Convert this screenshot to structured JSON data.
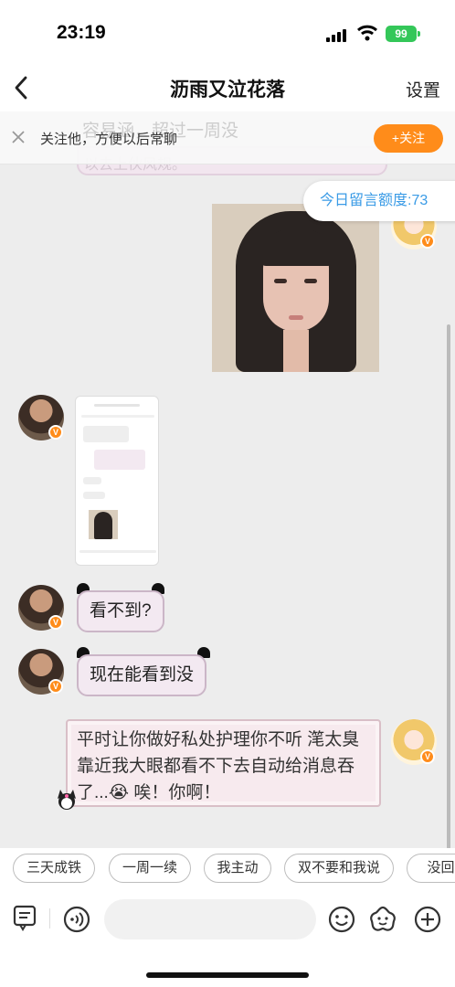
{
  "status": {
    "time": "23:19",
    "battery": "99"
  },
  "nav": {
    "title": "沥雨又泣花落",
    "settings": "设置"
  },
  "follow_banner": {
    "text": "关注他，方便以后常聊",
    "button": "+关注",
    "ghost": "容易涵，超过一周没"
  },
  "quota": {
    "label": "今日留言额度:73"
  },
  "partial_text": "以去上伙风规。",
  "messages": [
    {
      "side": "right",
      "kind": "photo"
    },
    {
      "side": "left",
      "kind": "screenshot"
    },
    {
      "side": "left",
      "kind": "text",
      "text": "看不到?"
    },
    {
      "side": "left",
      "kind": "text",
      "text": "现在能看到没"
    },
    {
      "side": "right",
      "kind": "text",
      "text": "平时让你做好私处护理你不听 滗太臭靠近我大眼都看不下去自动给消息吞了...😭 唉！你啊！"
    }
  ],
  "quick_replies": [
    "三天成铁",
    "一周一续",
    "我主动",
    "双不要和我说",
    "没回去"
  ],
  "input": {
    "placeholder": ""
  },
  "icons": [
    "back-icon",
    "close-icon",
    "notes-icon",
    "voice-icon",
    "emoji-icon",
    "sticker-icon",
    "plus-icon"
  ],
  "colors": {
    "accent": "#ff8c1a",
    "quota": "#3a9be6",
    "bubble": "#f3e9f1"
  }
}
